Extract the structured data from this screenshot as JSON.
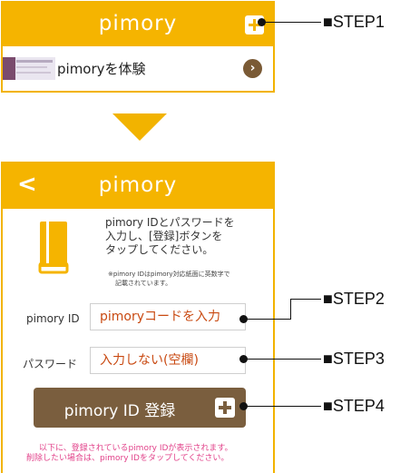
{
  "panel1": {
    "title": "pimory",
    "row_label": "pimoryを体験",
    "go_glyph": "›"
  },
  "panel2": {
    "back_glyph": "<",
    "title": "pimory",
    "instruction_lines": [
      "pimory IDとパスワードを",
      "入力し、[登録]ボタンを",
      "タップしてください。"
    ],
    "note_lines": [
      "※pimory IDはpimory対応紙面に英数字で",
      "記載されています。"
    ],
    "id_label": "pimory ID",
    "id_value": "pimoryコードを入力",
    "password_label": "パスワード",
    "password_value": "入力しない(空欄)",
    "register_label": "pimory ID 登録",
    "footer_lines": [
      "以下に、登録されているpimory IDが表示されます。",
      "削除したい場合は、pimory IDをタップしてください。"
    ]
  },
  "steps": {
    "step1": "■STEP1",
    "step2": "■STEP2",
    "step3": "■STEP3",
    "step4": "■STEP4"
  },
  "icons": [
    "plus-icon",
    "chevron-right-icon",
    "back-chevron-icon",
    "book-icon"
  ],
  "colors": {
    "accent": "#f5b400",
    "brown": "#7a5e3e",
    "input_text": "#c94a12",
    "footer_text": "#e2428a"
  }
}
